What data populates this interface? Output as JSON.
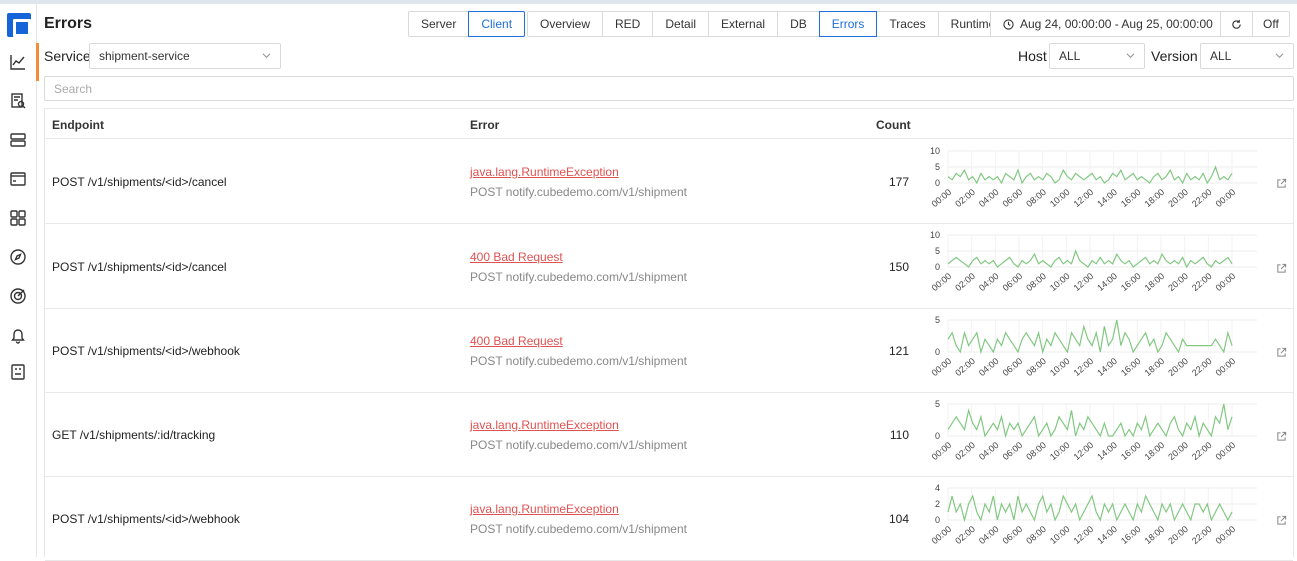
{
  "header": {
    "title": "Errors"
  },
  "direction_tabs": [
    {
      "label": "Server",
      "active": false
    },
    {
      "label": "Client",
      "active": true
    }
  ],
  "view_tabs": [
    {
      "label": "Overview",
      "active": false
    },
    {
      "label": "RED",
      "active": false
    },
    {
      "label": "Detail",
      "active": false
    },
    {
      "label": "External",
      "active": false
    },
    {
      "label": "DB",
      "active": false
    },
    {
      "label": "Errors",
      "active": true
    },
    {
      "label": "Traces",
      "active": false
    },
    {
      "label": "Runtime",
      "active": false
    }
  ],
  "time_range": {
    "label": "Aug 24, 00:00:00 - Aug 25, 00:00:00",
    "icon": "clock-icon"
  },
  "refresh": {
    "icon": "refresh-icon",
    "auto_label": "Off"
  },
  "filters": {
    "service_label": "Service",
    "service_value": "shipment-service",
    "host_label": "Host",
    "host_value": "ALL",
    "version_label": "Version",
    "version_value": "ALL"
  },
  "search": {
    "placeholder": "Search"
  },
  "table": {
    "columns": [
      "Endpoint",
      "Error",
      "Count"
    ],
    "x_ticks": [
      "00:00",
      "02:00",
      "04:00",
      "06:00",
      "08:00",
      "10:00",
      "12:00",
      "14:00",
      "16:00",
      "18:00",
      "20:00",
      "22:00",
      "00:00"
    ],
    "rows": [
      {
        "endpoint": "POST /v1/shipments/<id>/cancel",
        "error": "java.lang.RuntimeException",
        "error_target": "POST notify.cubedemo.com/v1/shipment",
        "count": "177",
        "y_ticks": [
          "10",
          "5",
          "0"
        ],
        "y_max": 10,
        "series": [
          2,
          1,
          3,
          2,
          4,
          1,
          2,
          0,
          3,
          1,
          2,
          1,
          2,
          0,
          3,
          2,
          1,
          4,
          0,
          2,
          3,
          1,
          2,
          1,
          3,
          2,
          0,
          1,
          4,
          2,
          1,
          3,
          2,
          1,
          2,
          3,
          1,
          2,
          0,
          1,
          3,
          2,
          4,
          1,
          2,
          3,
          1,
          2,
          1,
          0,
          2,
          3,
          1,
          2,
          4,
          1,
          2,
          0,
          3,
          1,
          2,
          1,
          3,
          0,
          2,
          5,
          1,
          2,
          1,
          3
        ]
      },
      {
        "endpoint": "POST /v1/shipments/<id>/cancel",
        "error": "400 Bad Request",
        "error_target": "POST notify.cubedemo.com/v1/shipment",
        "count": "150",
        "y_ticks": [
          "10",
          "5",
          "0"
        ],
        "y_max": 10,
        "series": [
          1,
          2,
          3,
          2,
          1,
          0,
          2,
          3,
          1,
          2,
          1,
          2,
          0,
          1,
          2,
          3,
          1,
          0,
          2,
          1,
          2,
          4,
          1,
          2,
          1,
          0,
          2,
          3,
          1,
          2,
          1,
          5,
          2,
          1,
          0,
          2,
          1,
          3,
          1,
          2,
          1,
          4,
          2,
          1,
          2,
          0,
          1,
          2,
          3,
          1,
          2,
          1,
          4,
          2,
          1,
          2,
          1,
          3,
          0,
          2,
          1,
          2,
          3,
          1,
          0,
          2,
          1,
          2,
          3,
          1
        ]
      },
      {
        "endpoint": "POST /v1/shipments/<id>/webhook",
        "error": "400 Bad Request",
        "error_target": "POST notify.cubedemo.com/v1/shipment",
        "count": "121",
        "y_ticks": [
          "5",
          "0"
        ],
        "y_max": 5,
        "series": [
          2,
          3,
          1,
          0,
          3,
          1,
          2,
          3,
          0,
          2,
          1,
          0,
          2,
          1,
          3,
          2,
          1,
          0,
          2,
          3,
          2,
          1,
          3,
          0,
          2,
          1,
          3,
          2,
          1,
          0,
          3,
          2,
          1,
          4,
          2,
          1,
          3,
          0,
          4,
          1,
          2,
          5,
          1,
          3,
          2,
          0,
          1,
          2,
          3,
          1,
          2,
          0,
          1,
          3,
          2,
          1,
          0,
          2,
          1,
          1,
          1,
          1,
          1,
          1,
          1,
          2,
          1,
          0,
          3,
          1
        ]
      },
      {
        "endpoint": "GET /v1/shipments/:id/tracking",
        "error": "java.lang.RuntimeException",
        "error_target": "POST notify.cubedemo.com/v1/shipment",
        "count": "110",
        "y_ticks": [
          "5",
          "0"
        ],
        "y_max": 5,
        "series": [
          1,
          2,
          3,
          2,
          1,
          4,
          2,
          1,
          3,
          0,
          1,
          2,
          1,
          3,
          0,
          2,
          1,
          2,
          0,
          1,
          2,
          3,
          0,
          1,
          2,
          0,
          1,
          3,
          2,
          1,
          4,
          0,
          2,
          1,
          3,
          2,
          1,
          0,
          2,
          0,
          0,
          1,
          2,
          0,
          1,
          0,
          2,
          1,
          3,
          0,
          1,
          2,
          1,
          0,
          2,
          3,
          1,
          0,
          2,
          1,
          3,
          0,
          2,
          1,
          0,
          3,
          2,
          5,
          1,
          3
        ]
      },
      {
        "endpoint": "POST /v1/shipments/<id>/webhook",
        "error": "java.lang.RuntimeException",
        "error_target": "POST notify.cubedemo.com/v1/shipment",
        "count": "104",
        "y_ticks": [
          "4",
          "2",
          "0"
        ],
        "y_max": 4,
        "series": [
          1,
          3,
          1,
          2,
          0,
          2,
          3,
          1,
          0,
          2,
          1,
          3,
          0,
          2,
          1,
          2,
          0,
          3,
          1,
          2,
          1,
          0,
          2,
          3,
          1,
          2,
          0,
          1,
          3,
          2,
          1,
          2,
          0,
          1,
          2,
          3,
          1,
          0,
          2,
          1,
          2,
          0,
          1,
          2,
          1,
          0,
          2,
          1,
          3,
          2,
          1,
          0,
          2,
          1,
          2,
          0,
          1,
          2,
          1,
          0,
          2,
          2,
          1,
          2,
          0,
          1,
          2,
          1,
          0,
          1
        ]
      }
    ]
  },
  "colors": {
    "accent": "#1e6fd9",
    "error": "#e05252",
    "spark": "#82c882",
    "active_nav": "#f28d3a"
  }
}
